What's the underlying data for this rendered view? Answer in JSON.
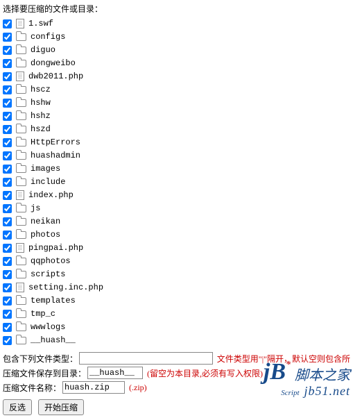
{
  "header": "选择要压缩的文件或目录：",
  "files": [
    {
      "name": "1.swf",
      "type": "file",
      "checked": true
    },
    {
      "name": "configs",
      "type": "folder",
      "checked": true
    },
    {
      "name": "diguo",
      "type": "folder",
      "checked": true
    },
    {
      "name": "dongweibo",
      "type": "folder",
      "checked": true
    },
    {
      "name": "dwb2011.php",
      "type": "file",
      "checked": true
    },
    {
      "name": "hscz",
      "type": "folder",
      "checked": true
    },
    {
      "name": "hshw",
      "type": "folder",
      "checked": true
    },
    {
      "name": "hshz",
      "type": "folder",
      "checked": true
    },
    {
      "name": "hszd",
      "type": "folder",
      "checked": true
    },
    {
      "name": "HttpErrors",
      "type": "folder",
      "checked": true
    },
    {
      "name": "huashadmin",
      "type": "folder",
      "checked": true
    },
    {
      "name": "images",
      "type": "folder",
      "checked": true
    },
    {
      "name": "include",
      "type": "folder",
      "checked": true
    },
    {
      "name": "index.php",
      "type": "file",
      "checked": true
    },
    {
      "name": "js",
      "type": "folder",
      "checked": true
    },
    {
      "name": "neikan",
      "type": "folder",
      "checked": true
    },
    {
      "name": "photos",
      "type": "folder",
      "checked": true
    },
    {
      "name": "pingpai.php",
      "type": "file",
      "checked": true
    },
    {
      "name": "qqphotos",
      "type": "folder",
      "checked": true
    },
    {
      "name": "scripts",
      "type": "folder",
      "checked": true
    },
    {
      "name": "setting.inc.php",
      "type": "file",
      "checked": true
    },
    {
      "name": "templates",
      "type": "folder",
      "checked": true
    },
    {
      "name": "tmp_c",
      "type": "folder",
      "checked": true
    },
    {
      "name": "wwwlogs",
      "type": "folder",
      "checked": true
    },
    {
      "name": "__huash__",
      "type": "folder",
      "checked": true
    }
  ],
  "form": {
    "include_types_label": "包含下列文件类型：",
    "include_types_value": "",
    "include_types_hint": "文件类型用\"|\"隔开，默认空则包含所",
    "save_dir_label": "压缩文件保存到目录：",
    "save_dir_value": "__huash__",
    "save_dir_hint": "(留空为本目录,必须有写入权限)",
    "file_name_label": "压缩文件名称：",
    "file_name_value": "huash.zip",
    "file_name_hint": "(.zip)"
  },
  "buttons": {
    "invert": "反选",
    "start": "开始压缩"
  },
  "watermark": {
    "jb": "jB",
    "star": "*",
    "cn": "脚本之家",
    "script": "Script",
    "url": "jb51.net"
  }
}
